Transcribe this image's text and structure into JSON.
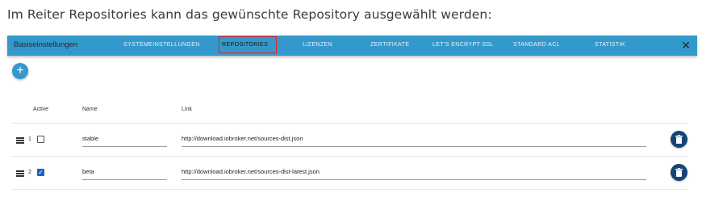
{
  "intro_text": "Im Reiter Repositories kann das gewünschte Repository ausgewählt werden:",
  "dialog": {
    "title": "Basiseinstellungen",
    "close_symbol": "✕",
    "tabs": [
      {
        "label": "SYSTEMEINSTELLUNGEN",
        "active": false
      },
      {
        "label": "REPOSITORIES",
        "active": true
      },
      {
        "label": "LIZENZEN",
        "active": false
      },
      {
        "label": "ZERTIFIKATE",
        "active": false
      },
      {
        "label": "LET'S ENCRYPT SSL",
        "active": false
      },
      {
        "label": "STANDARD ACL",
        "active": false
      },
      {
        "label": "STATISTIK",
        "active": false
      }
    ],
    "highlighted_tab": "REPOSITORIES",
    "add_symbol": "+",
    "columns": {
      "active": "Active",
      "name": "Name",
      "link": "Link"
    },
    "repositories": [
      {
        "index": "1",
        "active": false,
        "name": "stable",
        "link": "http://download.iobroker.net/sources-dist.json"
      },
      {
        "index": "2",
        "active": true,
        "name": "beta",
        "link": "http://download.iobroker.net/sources-dist-latest.json"
      }
    ]
  },
  "icons": {
    "add": "plus-icon",
    "close": "close-icon",
    "drag": "drag-handle-icon",
    "delete": "trash-icon"
  },
  "colors": {
    "appbar": "#3399cc",
    "active_tab_border": "#d9262c",
    "delete_button": "#164477",
    "checkbox_checked": "#1565c0"
  }
}
